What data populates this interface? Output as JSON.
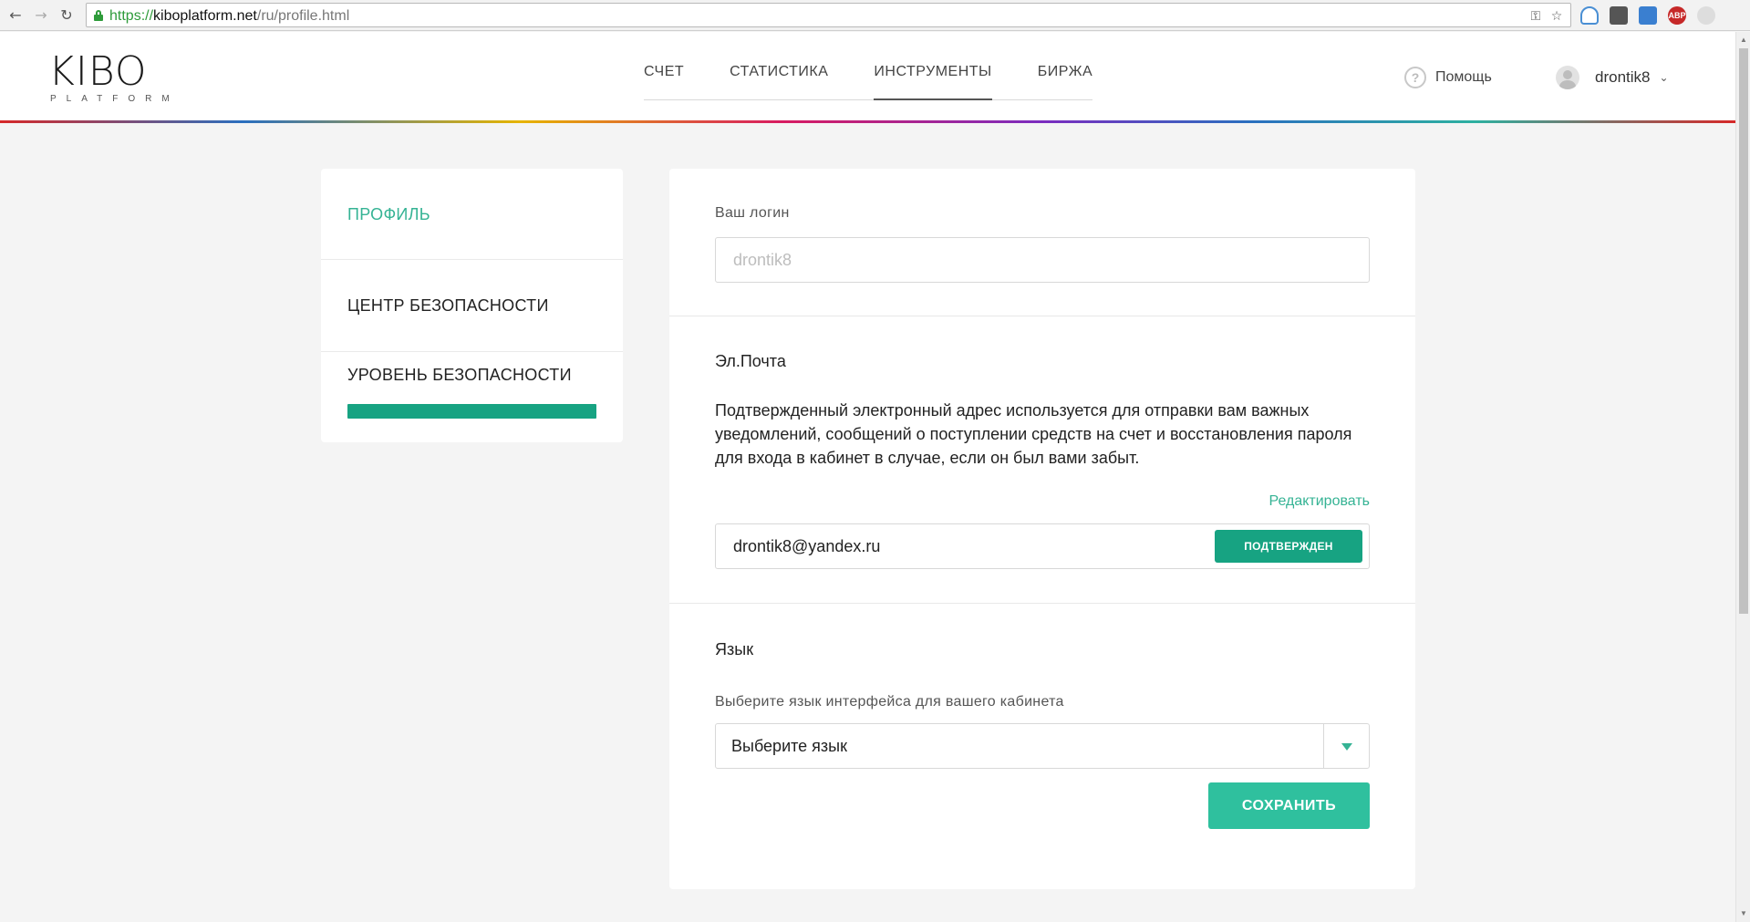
{
  "browser": {
    "url_scheme": "https://",
    "url_host": "kiboplatform.net",
    "url_path": "/ru/profile.html",
    "extension_abp": "ABP"
  },
  "header": {
    "logo_main": "KIBO",
    "logo_sub": "PLATFORM",
    "nav": [
      {
        "label": "СЧЕТ"
      },
      {
        "label": "СТАТИСТИКА"
      },
      {
        "label": "ИНСТРУМЕНТЫ"
      },
      {
        "label": "БИРЖА"
      }
    ],
    "help_label": "Помощь",
    "username": "drontik8"
  },
  "sidebar": {
    "items": [
      {
        "label": "ПРОФИЛЬ"
      },
      {
        "label": "ЦЕНТР БЕЗОПАСНОСТИ"
      },
      {
        "label": "УРОВЕНЬ БЕЗОПАСНОСТИ"
      }
    ],
    "security_level_fraction": 1.0
  },
  "profile": {
    "login_label": "Ваш логин",
    "login_value": "drontik8",
    "email_title": "Эл.Почта",
    "email_description": "Подтвержденный электронный адрес используется для отправки вам важных уведомлений, сообщений о поступлении средств на счет и восстановления пароля для входа в кабинет в случае, если он был вами забыт.",
    "edit_link": "Редактировать",
    "email_value": "drontik8@yandex.ru",
    "email_status": "ПОДТВЕРЖДЕН",
    "language_title": "Язык",
    "language_hint": "Выберите язык интерфейса для вашего кабинета",
    "language_selected": "Выберите язык",
    "save_label": "СОХРАНИТЬ"
  },
  "colors": {
    "accent": "#35b394",
    "accent_dark": "#17a382",
    "button": "#2fc09e"
  }
}
